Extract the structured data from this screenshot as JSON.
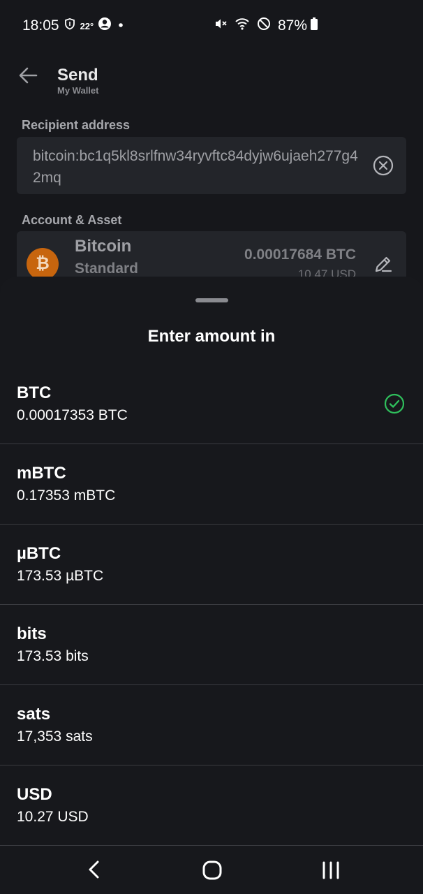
{
  "status_bar": {
    "time": "18:05",
    "temperature": "22°",
    "battery": "87%",
    "icons": [
      "shield-icon",
      "account-circle-icon",
      "dot-icon",
      "mute-icon",
      "wifi-icon",
      "do-not-disturb-icon",
      "battery-icon"
    ]
  },
  "header": {
    "title": "Send",
    "subtitle": "My Wallet",
    "back_icon": "arrow-left-icon"
  },
  "recipient": {
    "label": "Recipient address",
    "address": "bitcoin:bc1q5kl8srlfnw34ryvftc84dyjw6ujaeh277g42mq",
    "clear_icon": "clear-circle-icon"
  },
  "account": {
    "label": "Account & Asset",
    "asset_name": "Bitcoin",
    "asset_type": "Standard",
    "balance": "0.00017684 BTC",
    "fiat": "10.47 USD",
    "logo_letter": "₿",
    "edit_icon": "pencil-icon"
  },
  "sheet": {
    "title": "Enter amount in",
    "selected_index": 0,
    "options": [
      {
        "unit": "BTC",
        "value": "0.00017353 BTC"
      },
      {
        "unit": "mBTC",
        "value": "0.17353 mBTC"
      },
      {
        "unit": "µBTC",
        "value": "173.53 µBTC"
      },
      {
        "unit": "bits",
        "value": "173.53 bits"
      },
      {
        "unit": "sats",
        "value": "17,353 sats"
      },
      {
        "unit": "USD",
        "value": "10.27 USD"
      }
    ]
  },
  "nav_bar": {
    "icons": [
      "nav-back-icon",
      "nav-home-icon",
      "nav-recents-icon"
    ]
  },
  "colors": {
    "background": "#16171b",
    "card": "#23252a",
    "check_green": "#2fbf5c",
    "bitcoin_orange": "#c7650e"
  }
}
